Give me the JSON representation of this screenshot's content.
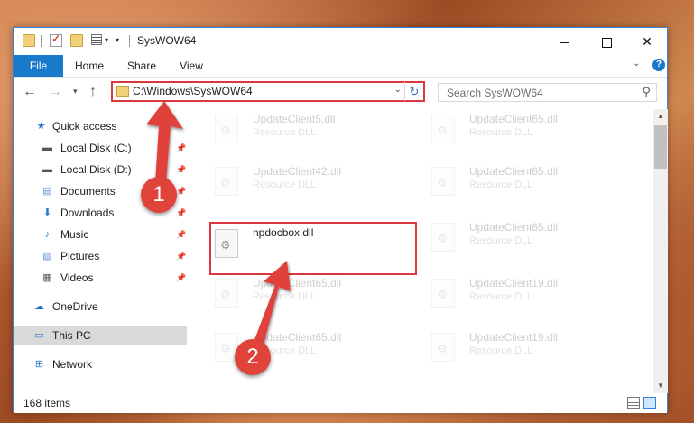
{
  "window": {
    "title": "SysWOW64",
    "minimize_icon": "minimize-icon",
    "maximize_icon": "maximize-icon",
    "close_glyph": "✕"
  },
  "quick_access_toolbar": {
    "icons": [
      "folder-icon",
      "properties-check-icon",
      "new-folder-icon",
      "properties-icon",
      "customize-dropdown-icon"
    ]
  },
  "ribbon": {
    "tabs": [
      "File",
      "Home",
      "Share",
      "View"
    ],
    "help_glyph": "?",
    "collapse_glyph": "⌄"
  },
  "navigation": {
    "back_glyph": "←",
    "forward_glyph": "→",
    "recent_glyph": "▾",
    "up_glyph": "↑",
    "address_path": "C:\\Windows\\SysWOW64",
    "address_dropdown_glyph": "⌄",
    "refresh_glyph": "↻",
    "search_placeholder": "Search SysWOW64",
    "search_glyph": "⚲"
  },
  "sidebar": {
    "items": [
      {
        "label": "Quick access",
        "icon": "star-icon",
        "glyph": "★",
        "color": "#2b79d0",
        "pinned": false
      },
      {
        "label": "Local Disk (C:)",
        "icon": "drive-icon",
        "glyph": "▬",
        "color": "#555555",
        "pinned": true
      },
      {
        "label": "Local Disk (D:)",
        "icon": "drive-icon",
        "glyph": "▬",
        "color": "#555555",
        "pinned": true
      },
      {
        "label": "Documents",
        "icon": "documents-icon",
        "glyph": "▤",
        "color": "#5b8ed6",
        "pinned": true
      },
      {
        "label": "Downloads",
        "icon": "downloads-icon",
        "glyph": "⬇",
        "color": "#2b79d0",
        "pinned": true
      },
      {
        "label": "Music",
        "icon": "music-icon",
        "glyph": "♪",
        "color": "#2b79d0",
        "pinned": true
      },
      {
        "label": "Pictures",
        "icon": "pictures-icon",
        "glyph": "▨",
        "color": "#5b8ed6",
        "pinned": true
      },
      {
        "label": "Videos",
        "icon": "videos-icon",
        "glyph": "▦",
        "color": "#555555",
        "pinned": true
      },
      {
        "label": "OneDrive",
        "icon": "onedrive-icon",
        "glyph": "☁",
        "color": "#1a6fc4",
        "pinned": false
      },
      {
        "label": "This PC",
        "icon": "this-pc-icon",
        "glyph": "▭",
        "color": "#2b79d0",
        "pinned": false,
        "selected": true
      },
      {
        "label": "Network",
        "icon": "network-icon",
        "glyph": "⊞",
        "color": "#2b79d0",
        "pinned": false
      }
    ],
    "pin_glyph": "📌"
  },
  "files": [
    {
      "name": "UpdateClient5.dll",
      "type": "Resource DLL",
      "faded": true
    },
    {
      "name": "UpdateClient65.dll",
      "type": "Resource DLL",
      "faded": true
    },
    {
      "name": "UpdateClient42.dll",
      "type": "Resource DLL",
      "faded": true
    },
    {
      "name": "UpdateClient65.dll",
      "type": "Resource DLL",
      "faded": true
    },
    {
      "name": "npdocbox.dll",
      "type": "",
      "faded": false,
      "highlighted": true
    },
    {
      "name": "UpdateClient65.dll",
      "type": "Resource DLL",
      "faded": true
    },
    {
      "name": "UpdateClient65.dll",
      "type": "Resource DLL",
      "faded": true
    },
    {
      "name": "UpdateClient19.dll",
      "type": "Resource DLL",
      "faded": true
    },
    {
      "name": "UpdateClient65.dll",
      "type": "Resource DLL",
      "faded": true
    },
    {
      "name": "UpdateClient19.dll",
      "type": "Resource DLL",
      "faded": true
    }
  ],
  "status": {
    "item_count": "168 items"
  },
  "annotations": {
    "step1": "1",
    "step2": "2",
    "color": "#e0433a"
  }
}
